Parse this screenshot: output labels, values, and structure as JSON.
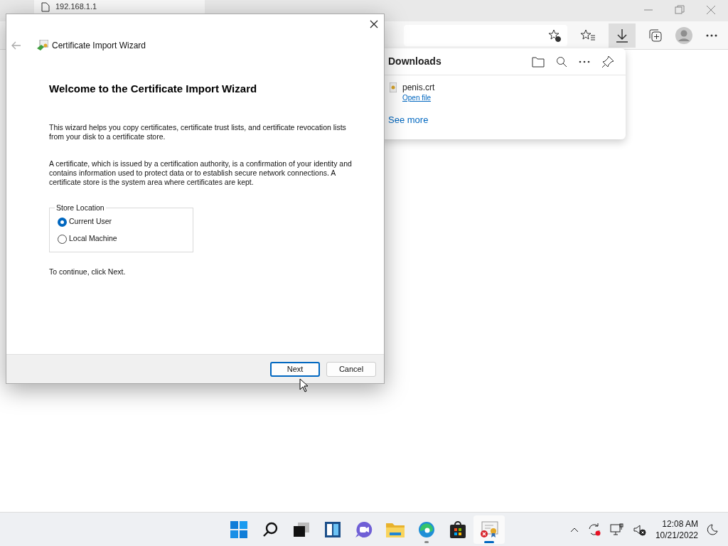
{
  "browser": {
    "tab": {
      "title": "192.168.1.1"
    },
    "downloads": {
      "title": "Downloads",
      "items": [
        {
          "name": "penis.crt",
          "action": "Open file"
        }
      ],
      "see_more": "See more"
    }
  },
  "dialog": {
    "title": "Certificate Import Wizard",
    "heading": "Welcome to the Certificate Import Wizard",
    "paragraphs": [
      "This wizard helps you copy certificates, certificate trust lists, and certificate revocation lists from your disk to a certificate store.",
      "A certificate, which is issued by a certification authority, is a confirmation of your identity and contains information used to protect data or to establish secure network connections. A certificate store is the system area where certificates are kept."
    ],
    "store_location": {
      "label": "Store Location",
      "options": [
        {
          "label": "Current User",
          "selected": true
        },
        {
          "label": "Local Machine",
          "selected": false
        }
      ]
    },
    "footer_text": "To continue, click Next.",
    "buttons": [
      {
        "label": "Next",
        "default": true
      },
      {
        "label": "Cancel",
        "default": false
      }
    ]
  },
  "taskbar": {
    "apps": [
      {
        "kind": "start",
        "running": false
      },
      {
        "kind": "search",
        "running": false
      },
      {
        "kind": "taskview",
        "running": false
      },
      {
        "kind": "widgets",
        "running": false
      },
      {
        "kind": "chat",
        "running": false
      },
      {
        "kind": "explorer",
        "running": false
      },
      {
        "kind": "edge",
        "running": true
      },
      {
        "kind": "store",
        "running": false
      },
      {
        "kind": "certificate",
        "running": true
      }
    ],
    "time": "12:08 AM",
    "date": "10/21/2022"
  }
}
